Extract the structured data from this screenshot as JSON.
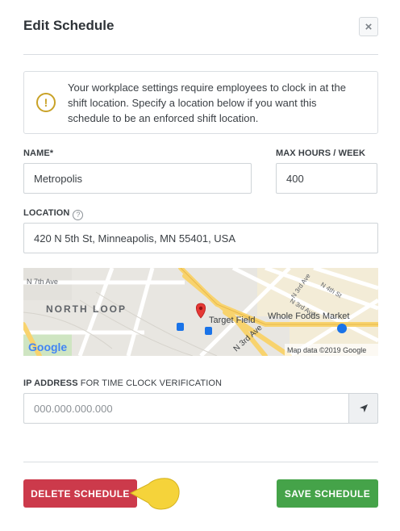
{
  "modal": {
    "title": "Edit Schedule",
    "close_glyph": "×"
  },
  "alert": {
    "icon": "exclamation-circle-icon",
    "icon_glyph": "!",
    "text": "Your workplace settings require employees to clock in at the shift location. Specify a location below if you want this schedule to be an enforced shift location."
  },
  "fields": {
    "name": {
      "label": "NAME*",
      "value": "Metropolis"
    },
    "max_hours": {
      "label": "MAX HOURS / WEEK",
      "value": "400"
    },
    "location": {
      "label": "LOCATION",
      "help_glyph": "?",
      "value": "420 N 5th St, Minneapolis, MN 55401, USA"
    },
    "ip": {
      "label_bold": "IP ADDRESS",
      "label_rest": " FOR TIME CLOCK VERIFICATION",
      "placeholder": "000.000.000.000",
      "locate_icon": "location-arrow-icon"
    }
  },
  "map": {
    "labels": {
      "n7th": "N 7th Ave",
      "north_loop": "NORTH LOOP",
      "target_field": "Target Field",
      "whole_foods": "Whole Foods Market",
      "n3rd_a": "N 3rd Ave",
      "n3rd_b": "N 3rd Ave",
      "n4th": "N 4th St",
      "n3rd_st": "N 3rd Ave"
    },
    "google": "Google",
    "attribution": "Map data ©2019 Google",
    "colors": {
      "land": "#e8e6e1",
      "road": "#ffffff",
      "highway": "#f8d36e",
      "poi": "#1a73e8",
      "pin": "#e53935"
    }
  },
  "buttons": {
    "delete": "DELETE SCHEDULE",
    "save": "SAVE SCHEDULE"
  },
  "colors": {
    "delete": "#cc3a4b",
    "save": "#45a349",
    "pointer": "#f5d33a"
  }
}
